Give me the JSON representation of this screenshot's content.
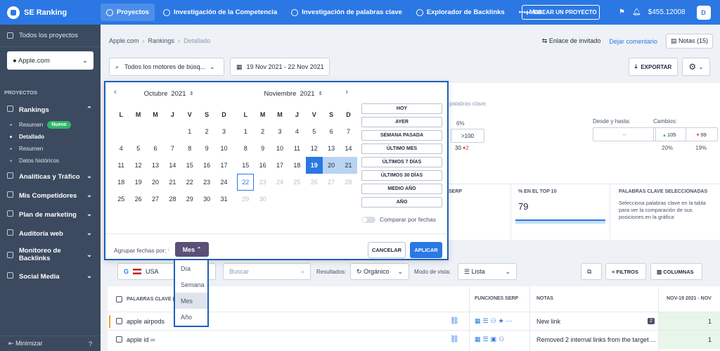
{
  "topbar": {
    "brand": "SE Ranking",
    "nav": [
      "Proyectos",
      "Investigación de la Competencia",
      "Investigación de palabras clave",
      "Explorador de Backlinks",
      "Mas"
    ],
    "create_label": "CREAR UN PROYECTO",
    "balance": "$455.12008",
    "avatar": "D"
  },
  "sidebar": {
    "all_projects": "Todos los proyectos",
    "project": "Apple.com",
    "section": "PROYECTOS",
    "rankings": "Rankings",
    "sub": [
      "Resumen",
      "Detallado",
      "Resumen",
      "Datos históricos"
    ],
    "new_badge": "Nuevo",
    "items": [
      "Analíticas y Tráfico",
      "Mis Competidores",
      "Plan de marketing",
      "Auditoría web",
      "Monitoreo de Backlinks",
      "Social Media"
    ],
    "minimize": "Minimizar"
  },
  "breadcrumb": [
    "Apple.com",
    "Rankings",
    "Detallado"
  ],
  "actions": {
    "invite": "Enlace de invitado",
    "comment": "Dejar comentario",
    "notes": "Notas (15)"
  },
  "filters": {
    "engines": "Todos los motores de búsq...",
    "dates": "19 Nov 2021 - 22 Nov 2021",
    "export": "EXPORTAR"
  },
  "calendar": {
    "left_month": "Octubre",
    "left_year": "2021",
    "right_month": "Noviembre",
    "right_year": "2021",
    "weekdays": [
      "L",
      "M",
      "M",
      "J",
      "V",
      "S",
      "D"
    ],
    "quick": [
      "HOY",
      "AYER",
      "SEMANA PASADA",
      "ÚLTIMO MES",
      "ÚLTIMOS 7 DÍAS",
      "ÚLTIMOS 30 DÍAS",
      "MEDIO AÑO",
      "AÑO"
    ],
    "compare": "Comparar por fechas",
    "group_label": "Agrupar fechas por:",
    "group_value": "Mes",
    "cancel": "CANCELAR",
    "apply": "APLICAR"
  },
  "dropdown": [
    "Día",
    "Semana",
    "Mes",
    "Año"
  ],
  "behind": {
    "kw_hint": "palabras clave.",
    "pct": "6%",
    "gt100": ">100",
    "val30": "30",
    "val2": "2",
    "desde": "Desde y hasta:",
    "cambios": "Cambios:",
    "up": "105",
    "down": "99",
    "p20": "20%",
    "p19": "19%",
    "serp": "SERP",
    "top10_label": "% EN EL TOP 10",
    "top10_value": "79",
    "selected_title": "PALABRAS CLAVE SELECCIONADAS",
    "selected_text": "Selecciona palabras clave en la tabla para ver la comparación de sus posiciones en la gráfica"
  },
  "toolbar": {
    "country": "USA",
    "search": "Buscar",
    "results_label": "Resultados:",
    "results_value": "Orgánico",
    "view_label": "Modo de vista:",
    "view_value": "Lista",
    "filters": "FILTROS",
    "columns": "COLUMNAS"
  },
  "table": {
    "headers": [
      "PALABRAS CLAVE (1",
      "FUNCIONES SERP",
      "NOTAS",
      "NOV-19 2021 - NOV"
    ],
    "rows": [
      {
        "kw": "apple airpods",
        "note": "New link",
        "count": "2",
        "pos": "1"
      },
      {
        "kw": "apple id",
        "note": "Removed 2 internal links from the target ...",
        "count": "",
        "pos": "1"
      }
    ]
  }
}
